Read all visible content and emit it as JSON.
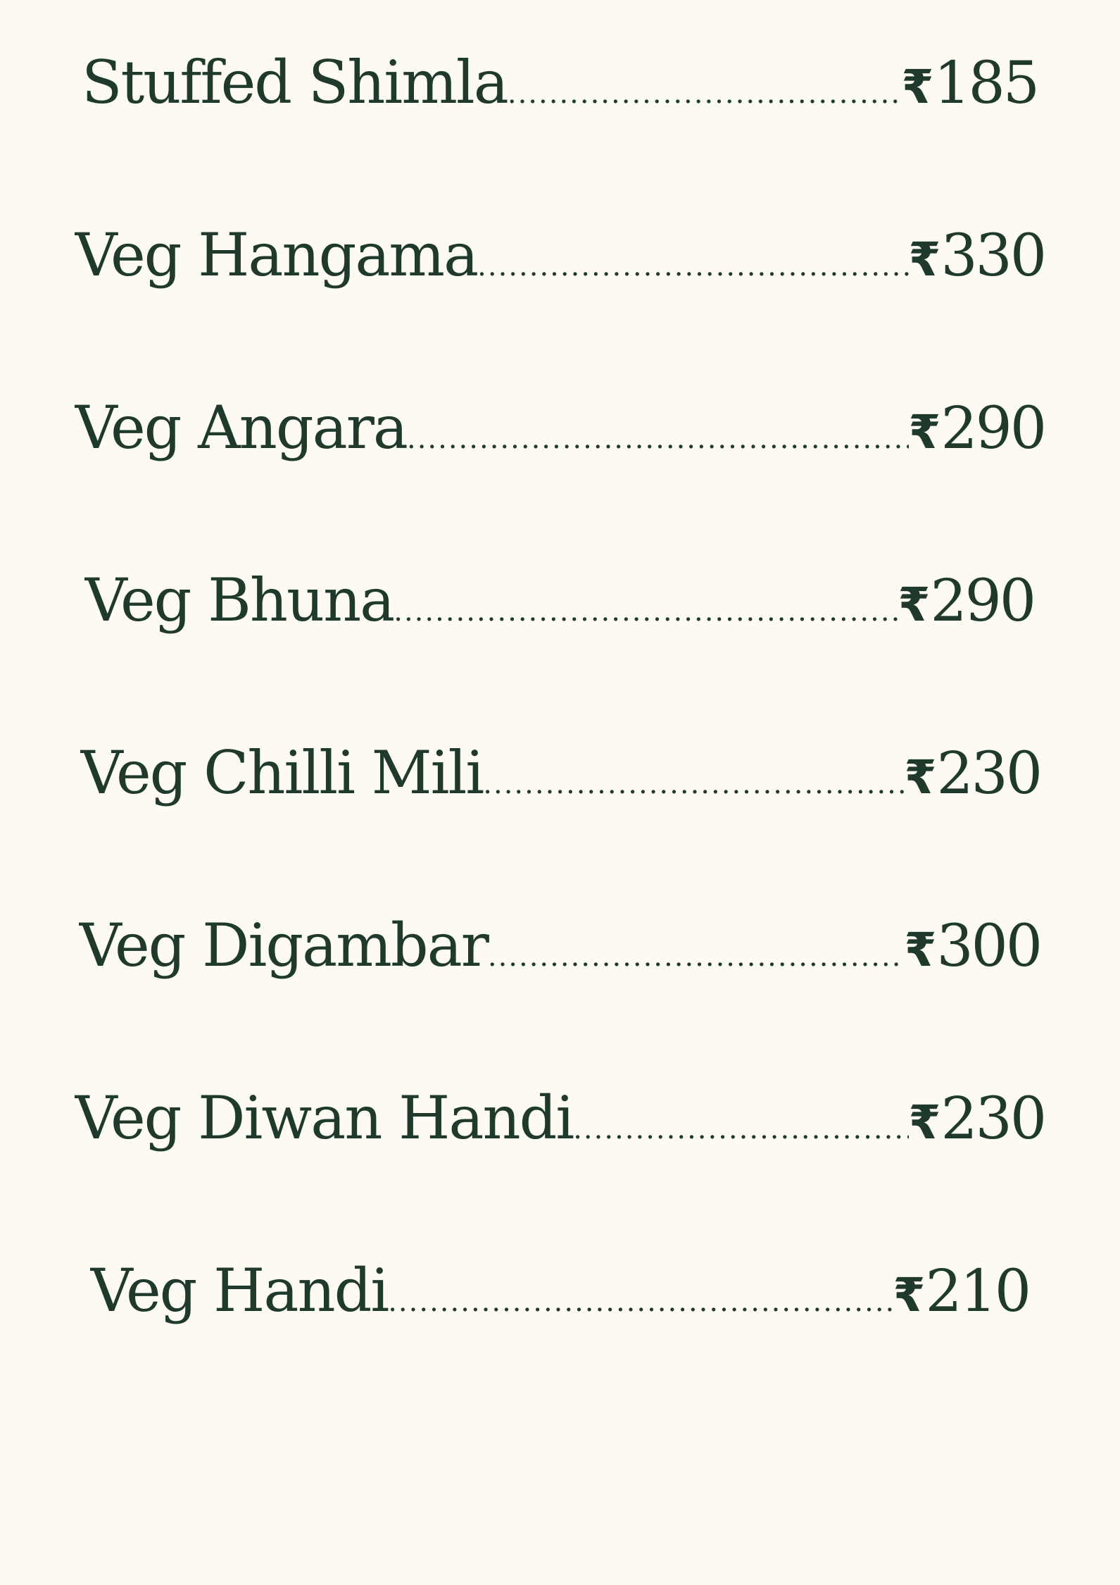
{
  "currency_symbol": "₹",
  "items": [
    {
      "name": "Stuffed Shimla",
      "price": "185"
    },
    {
      "name": "Veg Hangama",
      "price": "330"
    },
    {
      "name": "Veg Angara",
      "price": "290"
    },
    {
      "name": "Veg Bhuna",
      "price": "290"
    },
    {
      "name": "Veg Chilli Mili",
      "price": "230"
    },
    {
      "name": "Veg Digambar",
      "price": "300"
    },
    {
      "name": "Veg Diwan Handi",
      "price": "230"
    },
    {
      "name": "Veg Handi",
      "price": "210"
    }
  ],
  "colors": {
    "background": "#fdf9f3",
    "text": "#1f3a2b"
  }
}
